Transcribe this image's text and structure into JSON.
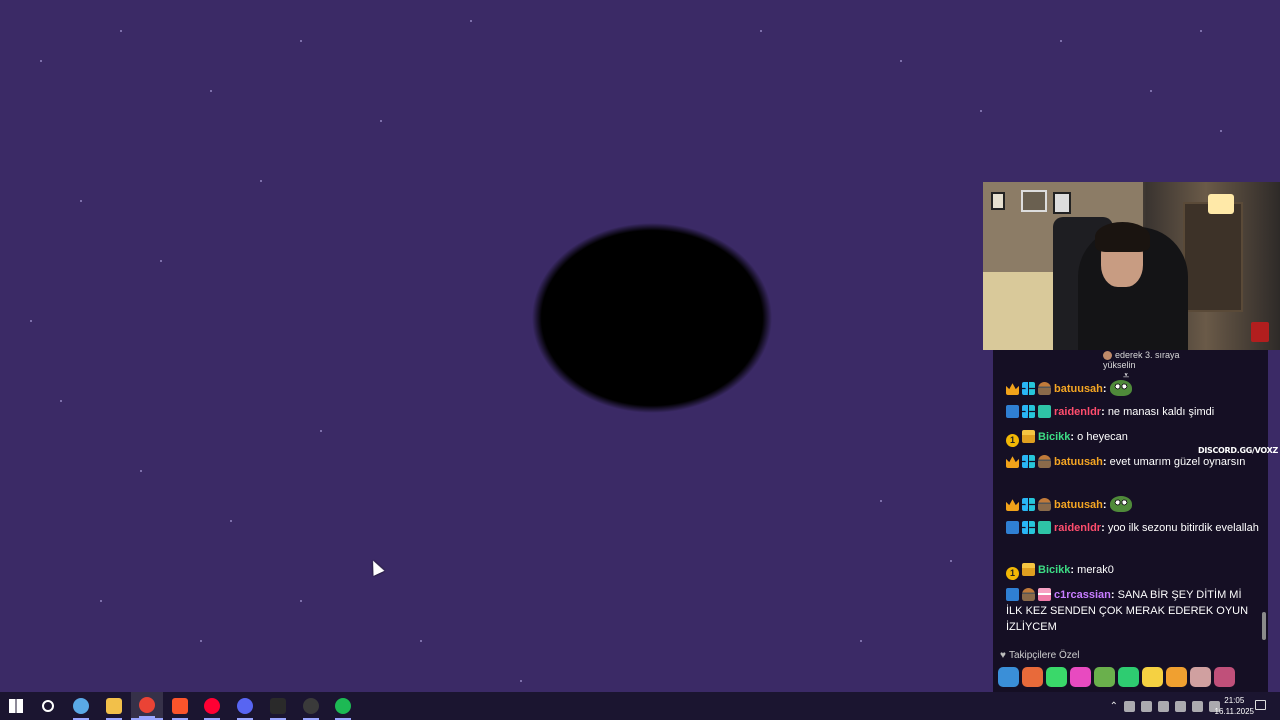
{
  "pinned": {
    "text_line1": "ederek 3. sıraya",
    "text_line2": "yükselin"
  },
  "discord_tag": "DISCORD.GG/VOXZ",
  "chat": [
    {
      "badges": [
        "crown",
        "grid",
        "hat"
      ],
      "user": "batuusah",
      "color": "#f5a623",
      "text": "",
      "emote": true
    },
    {
      "badges": [
        "sword",
        "grid",
        "chest"
      ],
      "user": "raidenldr",
      "color": "#ff4d6d",
      "text": "ne manası kaldı şimdi",
      "emote": false
    },
    {
      "badges": [
        "coin",
        "gift"
      ],
      "user": "Bicikk",
      "color": "#3ddc84",
      "text": "o heyecan",
      "emote": false
    },
    {
      "badges": [
        "crown",
        "grid",
        "hat"
      ],
      "user": "batuusah",
      "color": "#f5a623",
      "text": "evet umarım güzel oynarsın",
      "emote": false
    },
    {
      "badges": [
        "crown",
        "grid",
        "hat"
      ],
      "user": "batuusah",
      "color": "#f5a623",
      "text": "",
      "emote": true
    },
    {
      "badges": [
        "sword",
        "grid",
        "chest"
      ],
      "user": "raidenldr",
      "color": "#ff4d6d",
      "text": "yoo ilk sezonu bitirdik evelallah",
      "emote": false
    },
    {
      "badges": [
        "coin",
        "gift"
      ],
      "user": "Bicikk",
      "color": "#3ddc84",
      "text": "merak0",
      "emote": false
    },
    {
      "badges": [
        "sword",
        "hat",
        "cake"
      ],
      "user": "c1rcassian",
      "color": "#c77dff",
      "text": "SANA BİR ŞEY DİTİM Mİ İLK KEZ SENDEN ÇOK MERAK EDEREK OYUN İZLİYCEM",
      "emote": false
    }
  ],
  "coin_label": "1",
  "followers_label": "Takipçilere Özel",
  "emote_bar": [
    "#3a8fd8",
    "#e86a3a",
    "#3ad86a",
    "#e84ac0",
    "#6ab04c",
    "#2ecc71",
    "#f5d142",
    "#f0a030",
    "#d0a0a0",
    "#c0507a"
  ],
  "taskbar": {
    "icons": [
      {
        "name": "windows-start-icon",
        "color": "#ffffff"
      },
      {
        "name": "search-icon",
        "color": "#ffffff"
      },
      {
        "name": "steam-icon",
        "color": "#5aa9e6"
      },
      {
        "name": "file-explorer-icon",
        "color": "#f2c04a"
      },
      {
        "name": "chrome-icon",
        "color": "#ea4335"
      },
      {
        "name": "brave-icon",
        "color": "#fb542b"
      },
      {
        "name": "youtube-music-icon",
        "color": "#ff0033"
      },
      {
        "name": "discord-icon",
        "color": "#5865f2"
      },
      {
        "name": "terminal-icon",
        "color": "#2a2a2a"
      },
      {
        "name": "obs-icon",
        "color": "#3a3a3a"
      },
      {
        "name": "spotify-icon",
        "color": "#1db954"
      }
    ],
    "clock_time": "21:05",
    "clock_date": "16.11.2025"
  }
}
